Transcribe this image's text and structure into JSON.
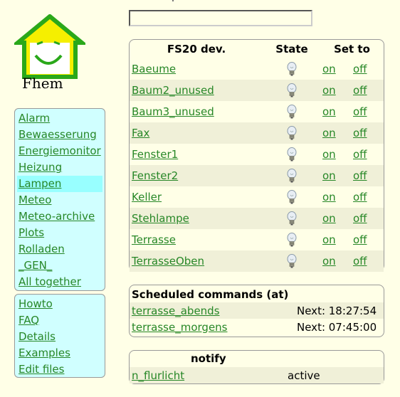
{
  "logo": {
    "text": "Fhem"
  },
  "command": {
    "value": ""
  },
  "menu_rooms": [
    {
      "label": "Alarm",
      "selected": false
    },
    {
      "label": "Bewaesserung",
      "selected": false
    },
    {
      "label": "Energiemonitor",
      "selected": false
    },
    {
      "label": "Heizung",
      "selected": false
    },
    {
      "label": "Lampen",
      "selected": true
    },
    {
      "label": "Meteo",
      "selected": false
    },
    {
      "label": "Meteo-archive",
      "selected": false
    },
    {
      "label": "Plots",
      "selected": false
    },
    {
      "label": "Rolladen",
      "selected": false
    },
    {
      "label": "_GEN_",
      "selected": false
    },
    {
      "label": "All together",
      "selected": false
    }
  ],
  "menu_help": [
    {
      "label": "Howto"
    },
    {
      "label": "FAQ"
    },
    {
      "label": "Details"
    },
    {
      "label": "Examples"
    },
    {
      "label": "Edit files"
    }
  ],
  "fs20": {
    "headers": {
      "device": "FS20 dev.",
      "state": "State",
      "set_to": "Set to"
    },
    "state_icon": "bulb-off-icon",
    "devices": [
      {
        "name": "Baeume",
        "on": "on",
        "off": "off"
      },
      {
        "name": "Baum2_unused",
        "on": "on",
        "off": "off"
      },
      {
        "name": "Baum3_unused",
        "on": "on",
        "off": "off"
      },
      {
        "name": "Fax",
        "on": "on",
        "off": "off"
      },
      {
        "name": "Fenster1",
        "on": "on",
        "off": "off"
      },
      {
        "name": "Fenster2",
        "on": "on",
        "off": "off"
      },
      {
        "name": "Keller",
        "on": "on",
        "off": "off"
      },
      {
        "name": "Stehlampe",
        "on": "on",
        "off": "off"
      },
      {
        "name": "Terrasse",
        "on": "on",
        "off": "off"
      },
      {
        "name": "TerrasseOben",
        "on": "on",
        "off": "off"
      }
    ]
  },
  "scheduled": {
    "title": "Scheduled commands (at)",
    "items": [
      {
        "name": "terrasse_abends",
        "next": "Next: 18:27:54"
      },
      {
        "name": "terrasse_morgens",
        "next": "Next: 07:45:00"
      }
    ]
  },
  "notify": {
    "title": "notify",
    "items": [
      {
        "name": "n_flurlicht",
        "state": "active"
      }
    ]
  },
  "colors": {
    "background": "#ffffe7",
    "link": "#278727",
    "menu_bg": "#d0ffff",
    "menu_selected": "#98ffff",
    "logo_green": "#2aa81a",
    "logo_yellow": "#f5ef00"
  }
}
